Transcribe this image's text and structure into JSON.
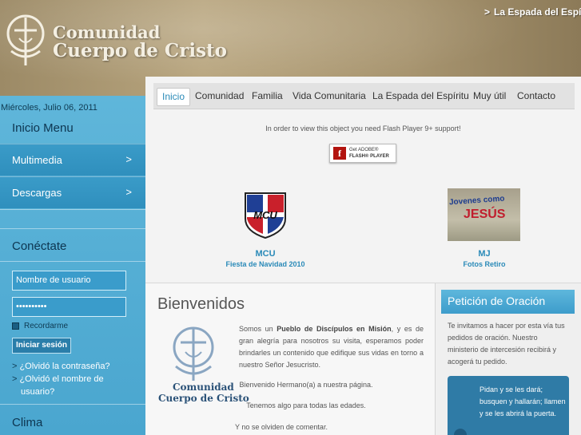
{
  "header": {
    "title_line1": "Comunidad",
    "title_line2": "Cuerpo de Cristo",
    "top_link": "La Espada del Espíritu",
    "top_link_arrow": ">"
  },
  "sidebar": {
    "date": "Miércoles, Julio 06, 2011",
    "menu_heading": "Inicio Menu",
    "menu_items": [
      {
        "label": "Multimedia",
        "chevron": ">"
      },
      {
        "label": "Descargas",
        "chevron": ">"
      }
    ],
    "login_heading": "Conéctate",
    "username_placeholder": "Nombre de usuario",
    "password_value": "••••••••••",
    "remember_label": "Recordarme",
    "login_button": "Iniciar sesión",
    "link_arrow": ">",
    "forgot_password": "¿Olvidó la contraseña?",
    "forgot_username_line1": "¿Olvidó el nombre de",
    "forgot_username_line2": "usuario?",
    "climate_heading": "Clima"
  },
  "nav": {
    "items": [
      "Inicio",
      "Comunidad",
      "Familia",
      "Vida Comunitaria",
      "La Espada del Espíritu",
      "Muy útil",
      "Contacto"
    ]
  },
  "flash": {
    "message": "In order to view this object you need Flash Player 9+ support!",
    "badge_glyph": "f",
    "badge_line1": "Get ADOBE®",
    "badge_line2": "FLASH® PLAYER"
  },
  "featured": [
    {
      "logo_text": "MCU",
      "title": "MCU",
      "subtitle": "Fiesta de Navidad 2010"
    },
    {
      "img_text1": "Jovenes como",
      "img_text2": "JESÚS",
      "title": "MJ",
      "subtitle": "Fotos Retiro"
    }
  ],
  "welcome": {
    "heading": "Bienvenidos",
    "logo_line1": "Comunidad",
    "logo_line2": "Cuerpo de Cristo",
    "para_pre": "Somos un ",
    "para_bold": "Pueblo de Discípulos en Misión",
    "para_post": ", y es de gran alegría para nosotros su visita, esperamos poder brindarles un contenido que edifique sus vidas en torno a nuestro Señor Jesucristo.",
    "line2": "Bienvenido Hermano(a) a nuestra página.",
    "line3": "Tenemos algo para todas las edades.",
    "line4": "Y no se olviden de comentar."
  },
  "petition": {
    "heading": "Petición de Oración",
    "text": "Te invitamos a hacer por esta vía tus pedidos de oración. Nuestro ministerio de intercesión recibirá y acogerá tu pedido.",
    "quote": "Pidan y se les dará; busquen y hallarán; llamen y se les abrirá la puerta."
  },
  "colors": {
    "accent": "#2a8ab8",
    "sidebar": "#4aa6cf",
    "header": "#a89570"
  }
}
